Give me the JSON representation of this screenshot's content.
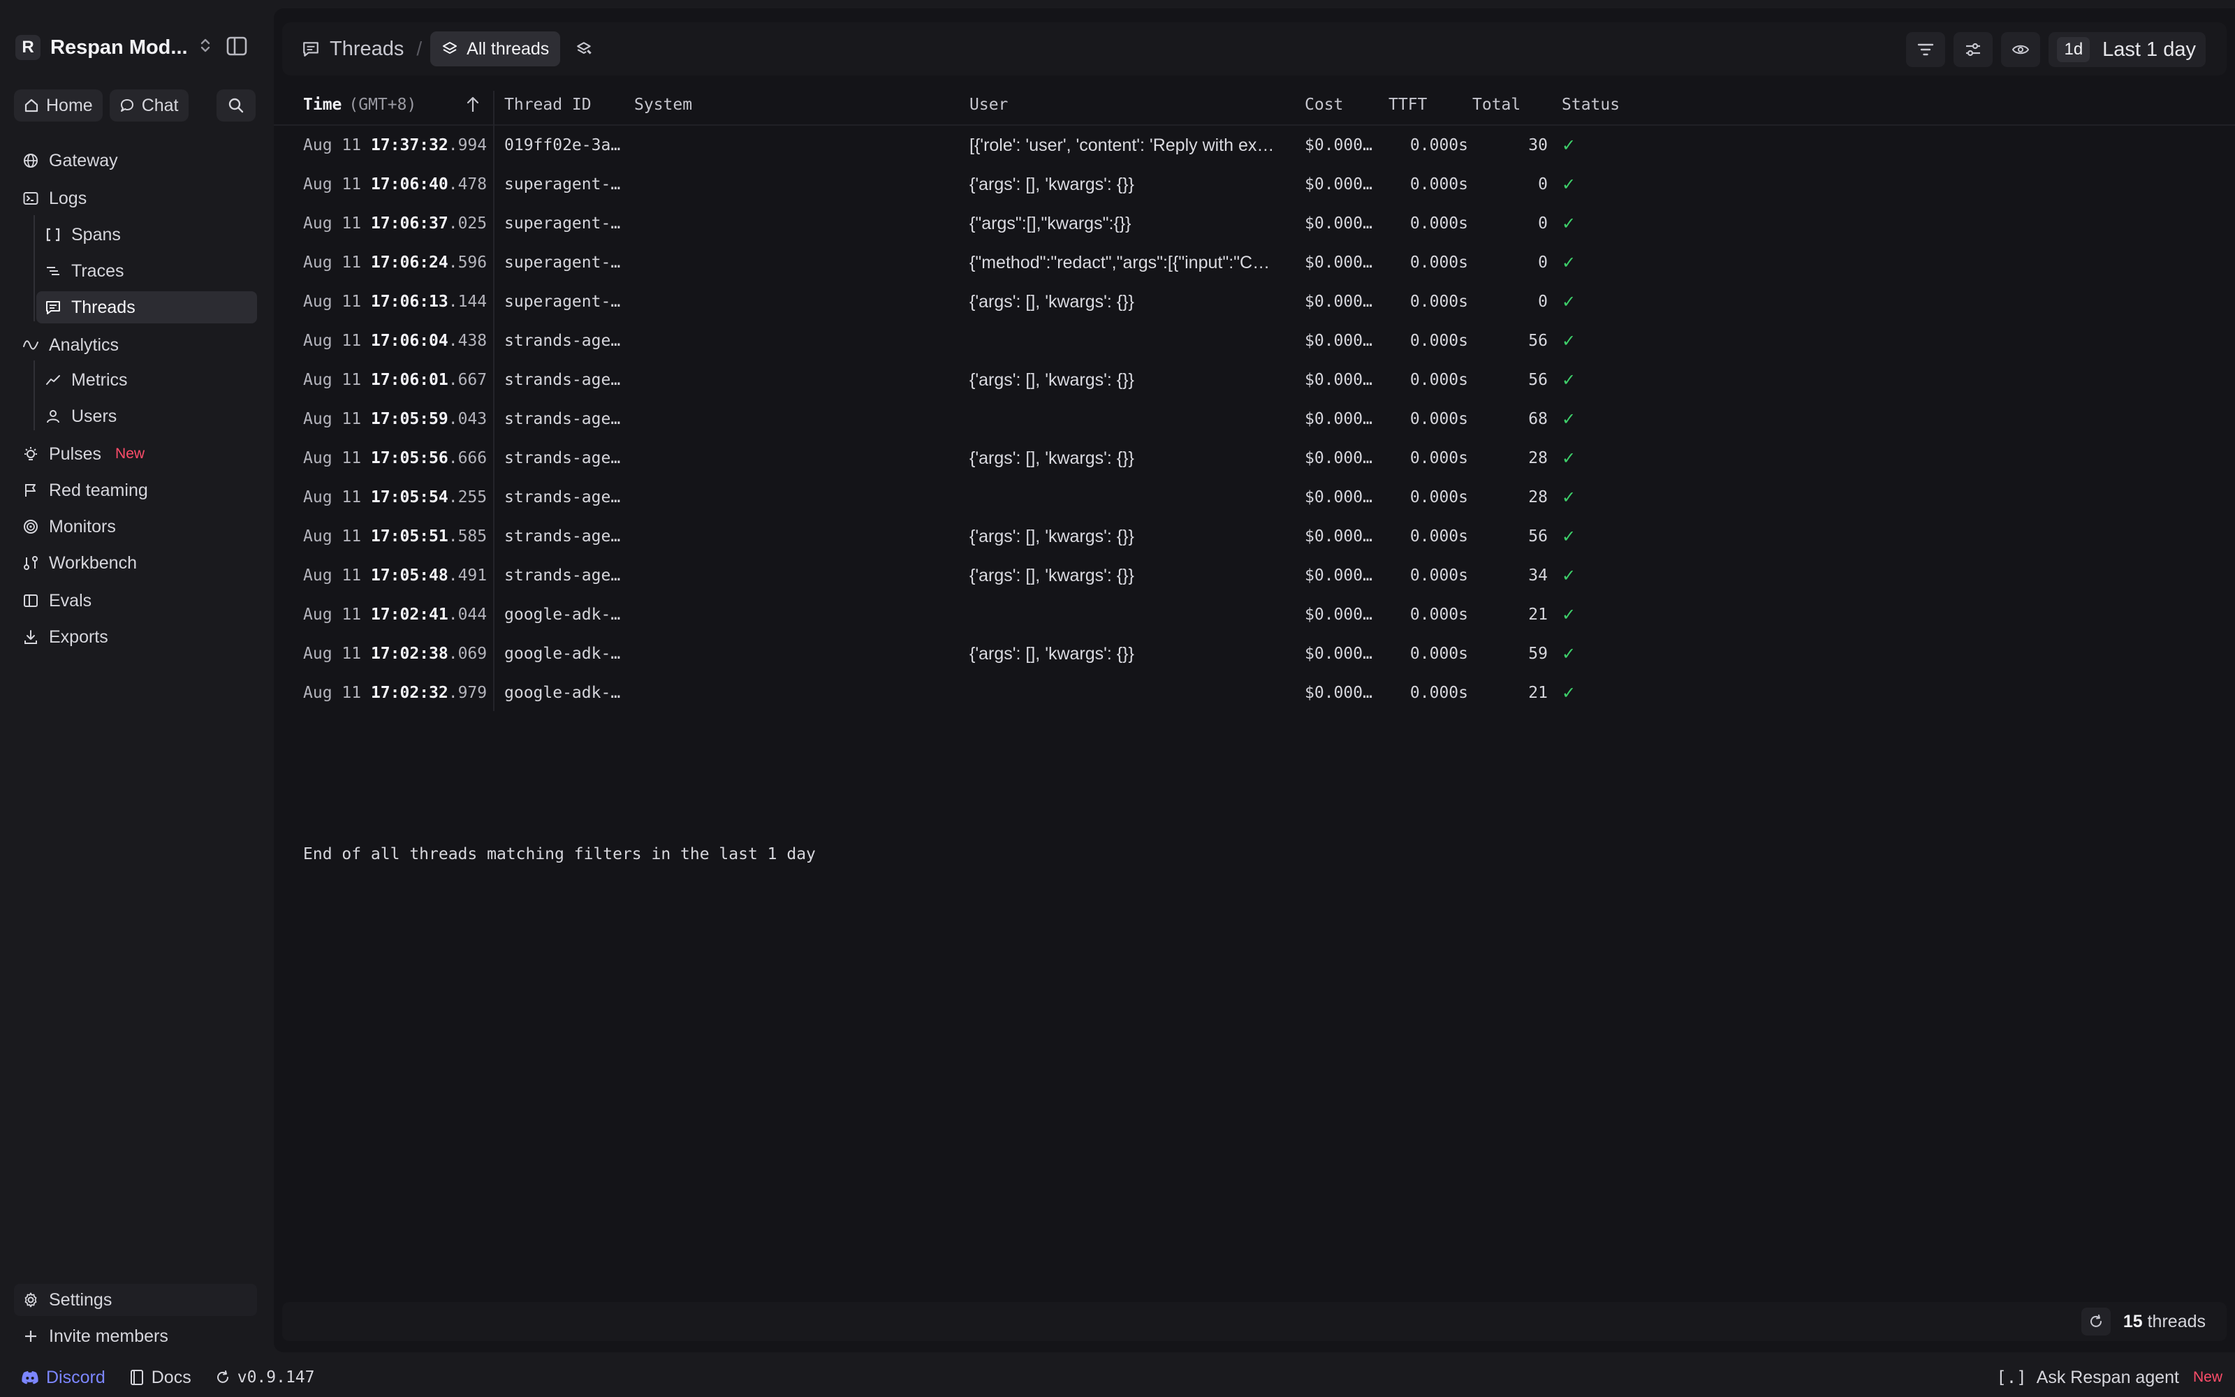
{
  "sidebar": {
    "org_initial": "R",
    "org_name": "Respan Mod...",
    "quick": {
      "home": "Home",
      "chat": "Chat"
    },
    "nav": {
      "gateway": "Gateway",
      "logs": "Logs",
      "spans": "Spans",
      "traces": "Traces",
      "threads": "Threads",
      "analytics": "Analytics",
      "metrics": "Metrics",
      "users": "Users",
      "pulses": "Pulses",
      "pulses_badge": "New",
      "red_teaming": "Red teaming",
      "monitors": "Monitors",
      "workbench": "Workbench",
      "evals": "Evals",
      "exports": "Exports"
    },
    "settings": "Settings",
    "invite": "Invite members",
    "footer": {
      "discord": "Discord",
      "docs": "Docs",
      "version": "v0.9.147"
    }
  },
  "ask_agent": {
    "label": "Ask Respan agent",
    "badge": "New"
  },
  "topbar": {
    "crumb": "Threads",
    "view": "All threads",
    "range_chip": "1d",
    "range_label": "Last 1 day"
  },
  "table": {
    "columns": {
      "time": "Time",
      "tz": "(GMT+8)",
      "thread_id": "Thread ID",
      "system": "System",
      "user": "User",
      "cost": "Cost",
      "ttft": "TTFT",
      "total": "Total",
      "status": "Status"
    },
    "rows": [
      {
        "date": "Aug 11",
        "hms": "17:37:32",
        "ms": ".994",
        "thread_id": "019ff02e-3a…",
        "system": "",
        "user": "[{'role': 'user', 'content': 'Reply with ex…",
        "cost": "$0.000…",
        "ttft": "0.000s",
        "total": "30",
        "status": "✓"
      },
      {
        "date": "Aug 11",
        "hms": "17:06:40",
        "ms": ".478",
        "thread_id": "superagent-…",
        "system": "",
        "user": "{'args': [], 'kwargs': {}}",
        "cost": "$0.000…",
        "ttft": "0.000s",
        "total": "0",
        "status": "✓"
      },
      {
        "date": "Aug 11",
        "hms": "17:06:37",
        "ms": ".025",
        "thread_id": "superagent-…",
        "system": "",
        "user": "{\"args\":[],\"kwargs\":{}}",
        "cost": "$0.000…",
        "ttft": "0.000s",
        "total": "0",
        "status": "✓"
      },
      {
        "date": "Aug 11",
        "hms": "17:06:24",
        "ms": ".596",
        "thread_id": "superagent-…",
        "system": "",
        "user": "{\"method\":\"redact\",\"args\":[{\"input\":\"C…",
        "cost": "$0.000…",
        "ttft": "0.000s",
        "total": "0",
        "status": "✓"
      },
      {
        "date": "Aug 11",
        "hms": "17:06:13",
        "ms": ".144",
        "thread_id": "superagent-…",
        "system": "",
        "user": "{'args': [], 'kwargs': {}}",
        "cost": "$0.000…",
        "ttft": "0.000s",
        "total": "0",
        "status": "✓"
      },
      {
        "date": "Aug 11",
        "hms": "17:06:04",
        "ms": ".438",
        "thread_id": "strands-age…",
        "system": "",
        "user": "",
        "cost": "$0.000…",
        "ttft": "0.000s",
        "total": "56",
        "status": "✓"
      },
      {
        "date": "Aug 11",
        "hms": "17:06:01",
        "ms": ".667",
        "thread_id": "strands-age…",
        "system": "",
        "user": "{'args': [], 'kwargs': {}}",
        "cost": "$0.000…",
        "ttft": "0.000s",
        "total": "56",
        "status": "✓"
      },
      {
        "date": "Aug 11",
        "hms": "17:05:59",
        "ms": ".043",
        "thread_id": "strands-age…",
        "system": "",
        "user": "",
        "cost": "$0.000…",
        "ttft": "0.000s",
        "total": "68",
        "status": "✓"
      },
      {
        "date": "Aug 11",
        "hms": "17:05:56",
        "ms": ".666",
        "thread_id": "strands-age…",
        "system": "",
        "user": "{'args': [], 'kwargs': {}}",
        "cost": "$0.000…",
        "ttft": "0.000s",
        "total": "28",
        "status": "✓"
      },
      {
        "date": "Aug 11",
        "hms": "17:05:54",
        "ms": ".255",
        "thread_id": "strands-age…",
        "system": "",
        "user": "",
        "cost": "$0.000…",
        "ttft": "0.000s",
        "total": "28",
        "status": "✓"
      },
      {
        "date": "Aug 11",
        "hms": "17:05:51",
        "ms": ".585",
        "thread_id": "strands-age…",
        "system": "",
        "user": "{'args': [], 'kwargs': {}}",
        "cost": "$0.000…",
        "ttft": "0.000s",
        "total": "56",
        "status": "✓"
      },
      {
        "date": "Aug 11",
        "hms": "17:05:48",
        "ms": ".491",
        "thread_id": "strands-age…",
        "system": "",
        "user": "{'args': [], 'kwargs': {}}",
        "cost": "$0.000…",
        "ttft": "0.000s",
        "total": "34",
        "status": "✓"
      },
      {
        "date": "Aug 11",
        "hms": "17:02:41",
        "ms": ".044",
        "thread_id": "google-adk-…",
        "system": "",
        "user": "",
        "cost": "$0.000…",
        "ttft": "0.000s",
        "total": "21",
        "status": "✓"
      },
      {
        "date": "Aug 11",
        "hms": "17:02:38",
        "ms": ".069",
        "thread_id": "google-adk-…",
        "system": "",
        "user": "{'args': [], 'kwargs': {}}",
        "cost": "$0.000…",
        "ttft": "0.000s",
        "total": "59",
        "status": "✓"
      },
      {
        "date": "Aug 11",
        "hms": "17:02:32",
        "ms": ".979",
        "thread_id": "google-adk-…",
        "system": "",
        "user": "",
        "cost": "$0.000…",
        "ttft": "0.000s",
        "total": "21",
        "status": "✓"
      }
    ],
    "end_text": "End of all threads matching filters in the last 1 day"
  },
  "statusbar": {
    "count": "15",
    "count_label": "threads"
  },
  "colors": {
    "accent_green": "#3ecf6a",
    "badge_red": "#ff4d6a",
    "discord": "#7c86ff"
  }
}
